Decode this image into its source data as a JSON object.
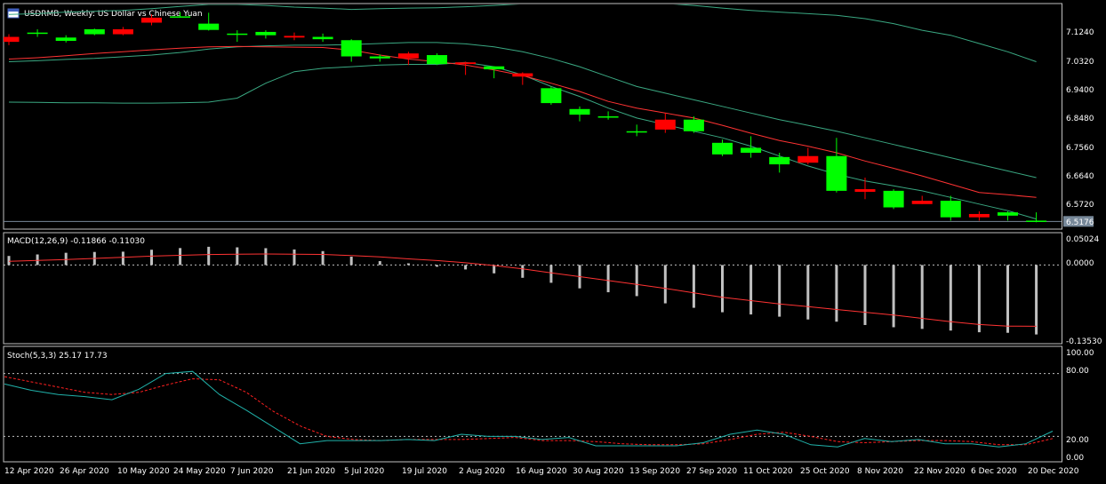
{
  "chart_data": {
    "type": "candlestick",
    "symbol": "USDRMB",
    "header": "USDRMB, Weekly:  US Dollar vs Chinese Yuan",
    "price_ticks": [
      "7.1240",
      "7.0320",
      "6.9400",
      "6.8480",
      "6.7560",
      "6.6640",
      "6.5720"
    ],
    "current_price": "6.5176",
    "x_labels": [
      "12 Apr 2020",
      "26 Apr 2020",
      "10 May 2020",
      "24 May 2020",
      "7 Jun 2020",
      "21 Jun 2020",
      "5 Jul 2020",
      "19 Jul 2020",
      "2 Aug 2020",
      "16 Aug 2020",
      "30 Aug 2020",
      "13 Sep 2020",
      "27 Sep 2020",
      "11 Oct 2020",
      "25 Oct 2020",
      "8 Nov 2020",
      "22 Nov 2020",
      "6 Dec 2020",
      "20 Dec 2020"
    ],
    "price_range": [
      6.497,
      7.173
    ],
    "candles": [
      {
        "o": 7.075,
        "h": 7.083,
        "l": 7.05,
        "c": 7.06
      },
      {
        "o": 7.088,
        "h": 7.098,
        "l": 7.075,
        "c": 7.088
      },
      {
        "o": 7.063,
        "h": 7.08,
        "l": 7.058,
        "c": 7.073
      },
      {
        "o": 7.083,
        "h": 7.1,
        "l": 7.08,
        "c": 7.098
      },
      {
        "o": 7.098,
        "h": 7.105,
        "l": 7.08,
        "c": 7.083
      },
      {
        "o": 7.133,
        "h": 7.143,
        "l": 7.11,
        "c": 7.118
      },
      {
        "o": 7.137,
        "h": 7.15,
        "l": 7.133,
        "c": 7.137
      },
      {
        "o": 7.096,
        "h": 7.148,
        "l": 7.094,
        "c": 7.115
      },
      {
        "o": 7.085,
        "h": 7.095,
        "l": 7.06,
        "c": 7.085
      },
      {
        "o": 7.08,
        "h": 7.095,
        "l": 7.07,
        "c": 7.09
      },
      {
        "o": 7.078,
        "h": 7.088,
        "l": 7.065,
        "c": 7.073
      },
      {
        "o": 7.068,
        "h": 7.085,
        "l": 7.06,
        "c": 7.075
      },
      {
        "o": 7.016,
        "h": 7.068,
        "l": 7.0,
        "c": 7.065
      },
      {
        "o": 7.01,
        "h": 7.022,
        "l": 7.0,
        "c": 7.016
      },
      {
        "o": 7.025,
        "h": 7.03,
        "l": 6.99,
        "c": 7.01
      },
      {
        "o": 6.993,
        "h": 7.025,
        "l": 6.99,
        "c": 7.02
      },
      {
        "o": 6.998,
        "h": 7.0,
        "l": 6.96,
        "c": 6.993
      },
      {
        "o": 6.977,
        "h": 6.986,
        "l": 6.95,
        "c": 6.986
      },
      {
        "o": 6.965,
        "h": 6.968,
        "l": 6.93,
        "c": 6.955
      },
      {
        "o": 6.875,
        "h": 6.925,
        "l": 6.87,
        "c": 6.92
      },
      {
        "o": 6.84,
        "h": 6.865,
        "l": 6.82,
        "c": 6.857
      },
      {
        "o": 6.835,
        "h": 6.85,
        "l": 6.825,
        "c": 6.835
      },
      {
        "o": 6.79,
        "h": 6.81,
        "l": 6.775,
        "c": 6.79
      },
      {
        "o": 6.825,
        "h": 6.845,
        "l": 6.785,
        "c": 6.795
      },
      {
        "o": 6.79,
        "h": 6.835,
        "l": 6.785,
        "c": 6.825
      },
      {
        "o": 6.72,
        "h": 6.765,
        "l": 6.715,
        "c": 6.755
      },
      {
        "o": 6.725,
        "h": 6.775,
        "l": 6.71,
        "c": 6.74
      },
      {
        "o": 6.69,
        "h": 6.725,
        "l": 6.665,
        "c": 6.712
      },
      {
        "o": 6.715,
        "h": 6.74,
        "l": 6.69,
        "c": 6.695
      },
      {
        "o": 6.61,
        "h": 6.77,
        "l": 6.605,
        "c": 6.715
      },
      {
        "o": 6.615,
        "h": 6.65,
        "l": 6.585,
        "c": 6.607
      },
      {
        "o": 6.56,
        "h": 6.615,
        "l": 6.555,
        "c": 6.61
      },
      {
        "o": 6.58,
        "h": 6.595,
        "l": 6.57,
        "c": 6.57
      },
      {
        "o": 6.53,
        "h": 6.595,
        "l": 6.52,
        "c": 6.58
      },
      {
        "o": 6.54,
        "h": 6.548,
        "l": 6.52,
        "c": 6.53
      },
      {
        "o": 6.535,
        "h": 6.548,
        "l": 6.52,
        "c": 6.545
      },
      {
        "o": 6.518,
        "h": 6.545,
        "l": 6.515,
        "c": 6.52
      }
    ],
    "ma": [
      7.008,
      7.012,
      7.018,
      7.025,
      7.03,
      7.036,
      7.041,
      7.045,
      7.046,
      7.045,
      7.044,
      7.043,
      7.035,
      7.02,
      7.008,
      7.0,
      6.99,
      6.975,
      6.958,
      6.935,
      6.91,
      6.88,
      6.86,
      6.845,
      6.83,
      6.808,
      6.784,
      6.762,
      6.745,
      6.725,
      6.7,
      6.678,
      6.655,
      6.63,
      6.605,
      6.598,
      6.59
    ],
    "bb_upper": [
      7.143,
      7.145,
      7.15,
      7.152,
      7.155,
      7.16,
      7.167,
      7.173,
      7.173,
      7.17,
      7.165,
      7.162,
      7.158,
      7.16,
      7.162,
      7.163,
      7.166,
      7.17,
      7.175,
      7.18,
      7.182,
      7.18,
      7.178,
      7.176,
      7.17,
      7.162,
      7.155,
      7.15,
      7.145,
      7.14,
      7.13,
      7.115,
      7.095,
      7.08,
      7.055,
      7.03,
      7.0
    ],
    "bb_middle": [
      7.0,
      7.003,
      7.007,
      7.01,
      7.015,
      7.02,
      7.028,
      7.038,
      7.045,
      7.048,
      7.05,
      7.05,
      7.052,
      7.055,
      7.058,
      7.058,
      7.054,
      7.045,
      7.03,
      7.01,
      6.985,
      6.955,
      6.925,
      6.905,
      6.885,
      6.865,
      6.845,
      6.825,
      6.808,
      6.79,
      6.77,
      6.75,
      6.73,
      6.71,
      6.69,
      6.67,
      6.65
    ],
    "bb_lower": [
      6.878,
      6.877,
      6.876,
      6.876,
      6.875,
      6.875,
      6.876,
      6.878,
      6.89,
      6.935,
      6.97,
      6.98,
      6.985,
      6.99,
      6.992,
      6.992,
      6.998,
      6.985,
      6.96,
      6.925,
      6.895,
      6.86,
      6.83,
      6.81,
      6.79,
      6.77,
      6.745,
      6.715,
      6.685,
      6.66,
      6.64,
      6.625,
      6.61,
      6.59,
      6.57,
      6.55,
      6.525
    ],
    "macd": {
      "header": "MACD(12,26,9) -0.11866 -0.11030",
      "ticks": [
        "0.05024",
        "0.0000",
        "-0.13530"
      ],
      "range": [
        -0.14,
        0.055
      ],
      "hist": [
        0.0163,
        0.019,
        0.022,
        0.0235,
        0.024,
        0.0275,
        0.0305,
        0.0328,
        0.0318,
        0.0303,
        0.028,
        0.025,
        0.015,
        0.007,
        0.003,
        -0.003,
        -0.008,
        -0.015,
        -0.023,
        -0.032,
        -0.042,
        -0.049,
        -0.056,
        -0.069,
        -0.077,
        -0.085,
        -0.089,
        -0.093,
        -0.098,
        -0.102,
        -0.108,
        -0.112,
        -0.115,
        -0.118,
        -0.121,
        -0.122,
        -0.125
      ],
      "signal": [
        0.0068,
        0.0082,
        0.01,
        0.0118,
        0.014,
        0.016,
        0.0175,
        0.0188,
        0.0195,
        0.0198,
        0.0195,
        0.019,
        0.017,
        0.0145,
        0.011,
        0.008,
        0.004,
        -0.001,
        -0.007,
        -0.014,
        -0.021,
        -0.028,
        -0.035,
        -0.042,
        -0.05,
        -0.058,
        -0.064,
        -0.07,
        -0.075,
        -0.08,
        -0.085,
        -0.09,
        -0.096,
        -0.102,
        -0.107,
        -0.11,
        -0.1103
      ]
    },
    "stoch": {
      "header": "Stoch(5,3,3) 25.17 17.73",
      "ticks": [
        "100.00",
        "80.00",
        "20.00",
        "0.00"
      ],
      "levels": [
        80,
        20
      ],
      "main": [
        70,
        64,
        60,
        58,
        55,
        65,
        80,
        82,
        60,
        45,
        29,
        13,
        16,
        16,
        16,
        17,
        16,
        22,
        20,
        20,
        17,
        19,
        11,
        11,
        11,
        11,
        14,
        22,
        26,
        22,
        12,
        10,
        18,
        15,
        17,
        13,
        13,
        10,
        13,
        25
      ],
      "signal": [
        77,
        72,
        67,
        62,
        60,
        62,
        69,
        75,
        74,
        62,
        44,
        30,
        20,
        17,
        16,
        17,
        17,
        17,
        18,
        19,
        16,
        16,
        15,
        13,
        12,
        12,
        13,
        17,
        22,
        24,
        20,
        15,
        14,
        15,
        16,
        16,
        15,
        12,
        12,
        18
      ]
    },
    "colors": {
      "bull": "#00ff00",
      "bear": "#ff0000",
      "ma": "#ff3333",
      "bands": "#3aa882",
      "stoch_main": "#20b2aa",
      "stoch_signal": "#ff2020",
      "hist": "#c0c0c0",
      "grid": "#c0c0c0",
      "price_tag": "#778899"
    }
  }
}
